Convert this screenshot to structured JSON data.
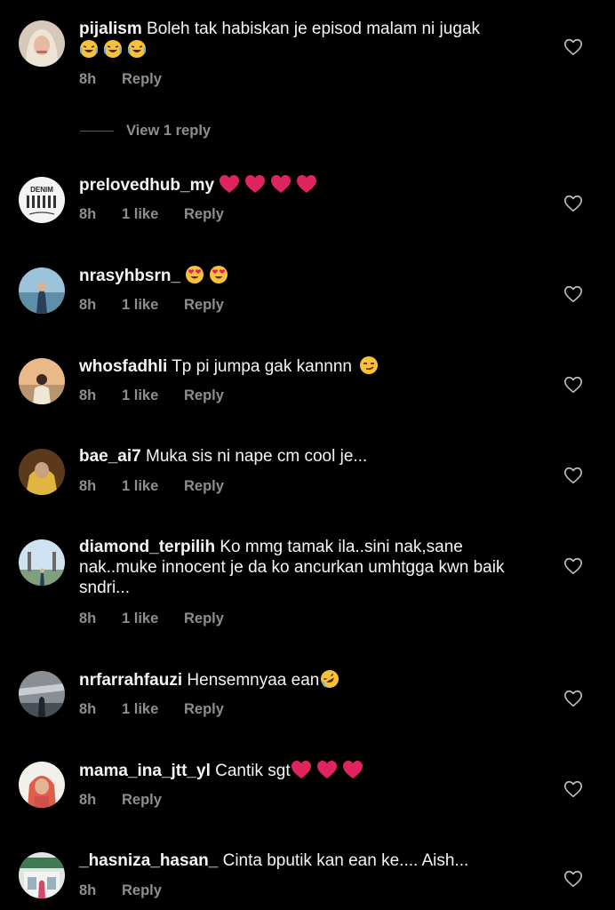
{
  "comments": [
    {
      "username": "pijalism",
      "text": "Boleh tak habiskan je episod malam ni jugak",
      "time": "8h",
      "likes": "",
      "reply": "Reply",
      "emojis": "😂😂😂"
    },
    {
      "username": "prelovedhub_my",
      "text": "",
      "time": "8h",
      "likes": "1 like",
      "reply": "Reply",
      "emojis": "❤️❤️❤️❤️"
    },
    {
      "username": "nrasyhbsrn_",
      "text": "",
      "time": "8h",
      "likes": "1 like",
      "reply": "Reply",
      "emojis": "😍😍"
    },
    {
      "username": "whosfadhli",
      "text": "Tp pi jumpa gak kannnn",
      "time": "8h",
      "likes": "1 like",
      "reply": "Reply",
      "emojis": "😏"
    },
    {
      "username": "bae_ai7",
      "text": "Muka sis ni nape cm cool je...",
      "time": "8h",
      "likes": "1 like",
      "reply": "Reply"
    },
    {
      "username": "diamond_terpilih",
      "text": "Ko mmg tamak ila..sini nak,sane nak..muke innocent je da ko ancurkan umhtgga kwn baik sndri...",
      "time": "8h",
      "likes": "1 like",
      "reply": "Reply"
    },
    {
      "username": "nrfarrahfauzi",
      "text": "Hensemnyaa ean",
      "time": "8h",
      "likes": "1 like",
      "reply": "Reply",
      "emojis": "🤣"
    },
    {
      "username": "mama_ina_jtt_yl",
      "text": "Cantik sgt",
      "time": "8h",
      "likes": "",
      "reply": "Reply",
      "emojis": "❤️❤️❤️"
    },
    {
      "username": "_hasniza_hasan_",
      "text": "Cinta bputik kan ean ke.... Aish...",
      "time": "8h",
      "likes": "",
      "reply": "Reply"
    }
  ],
  "view_replies": "View 1 reply",
  "avatar_logo_text": "DENIM",
  "icons": {
    "like": "heart-outline-icon"
  },
  "colors": {
    "background": "#000000",
    "text": "#f5f5f5",
    "meta": "#8e8e8e",
    "emoji_heart": "#e0245e"
  }
}
